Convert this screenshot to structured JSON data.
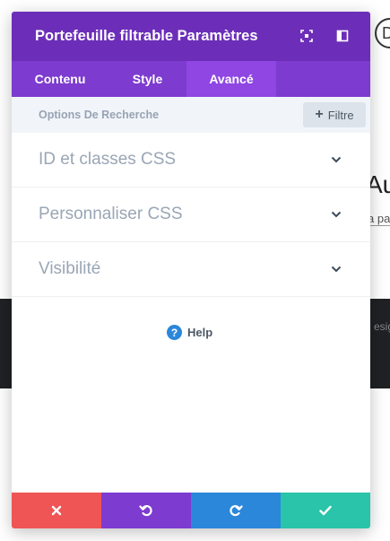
{
  "background": {
    "heading_fragment": "Au",
    "sub_fragment": "a pa",
    "dark_fragment": "esig",
    "circle_letter": "D"
  },
  "modal": {
    "title": "Portefeuille filtrable Paramètres",
    "header_icons": [
      "expand-icon",
      "sidebar-toggle-icon"
    ],
    "tabs": [
      {
        "label": "Contenu",
        "active": false
      },
      {
        "label": "Style",
        "active": false
      },
      {
        "label": "Avancé",
        "active": true
      }
    ],
    "search": {
      "placeholder": "Options De Recherche",
      "filter_label": "Filtre"
    },
    "toggles": [
      {
        "label": "ID et classes CSS"
      },
      {
        "label": "Personnaliser CSS"
      },
      {
        "label": "Visibilité"
      }
    ],
    "help_label": "Help",
    "footer_buttons": [
      "cancel-icon",
      "undo-icon",
      "redo-icon",
      "check-icon"
    ]
  },
  "colors": {
    "header": "#6c2eb9",
    "tabs": "#7d3bcf",
    "active_tab": "#8f46e3",
    "cancel": "#ef5555",
    "undo": "#7e3bd0",
    "redo": "#2b87da",
    "save": "#29c4a9"
  }
}
